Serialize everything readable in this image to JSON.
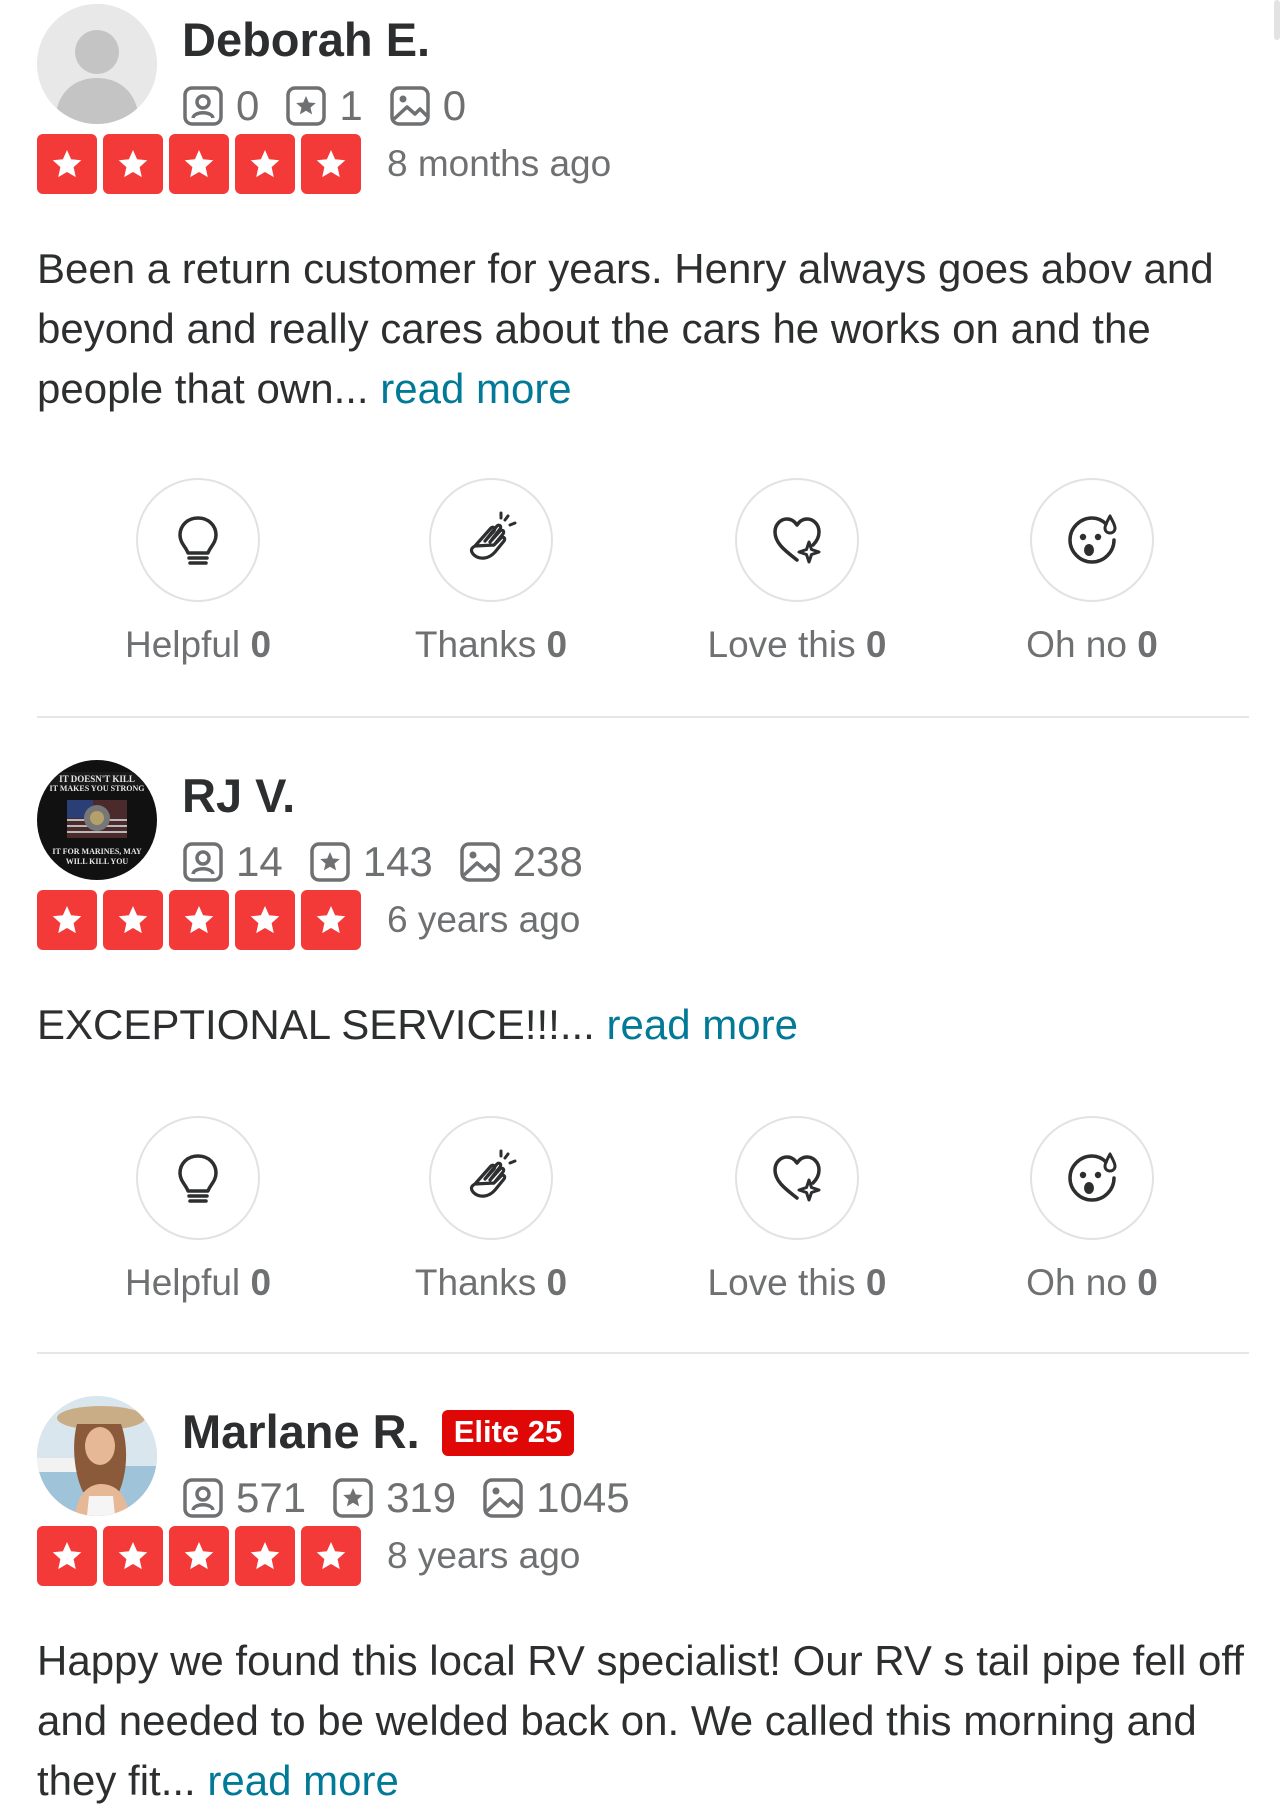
{
  "colors": {
    "star_red": "#f43939",
    "elite_red": "#e00707",
    "link": "#027a97",
    "muted": "#6e7072"
  },
  "reviews": [
    {
      "name": "Deborah E.",
      "elite": "",
      "avatar": "default-avatar-icon",
      "friends": "0",
      "reviews": "1",
      "photos": "0",
      "rating": 5,
      "date": "8 months ago",
      "text": "Been a return customer for years. Henry always goes abov and beyond and really cares about the cars he works on and the people that own...",
      "read_more": "read more",
      "reactions": {
        "helpful": {
          "label": "Helpful",
          "count": "0"
        },
        "thanks": {
          "label": "Thanks",
          "count": "0"
        },
        "love": {
          "label": "Love this",
          "count": "0"
        },
        "ohno": {
          "label": "Oh no",
          "count": "0"
        }
      }
    },
    {
      "name": "RJ V.",
      "elite": "",
      "avatar": "marine-emblem-photo",
      "friends": "14",
      "reviews": "143",
      "photos": "238",
      "rating": 5,
      "date": "6 years ago",
      "text": "EXCEPTIONAL SERVICE!!!...",
      "read_more": "read more",
      "reactions": {
        "helpful": {
          "label": "Helpful",
          "count": "0"
        },
        "thanks": {
          "label": "Thanks",
          "count": "0"
        },
        "love": {
          "label": "Love this",
          "count": "0"
        },
        "ohno": {
          "label": "Oh no",
          "count": "0"
        }
      }
    },
    {
      "name": "Marlane R.",
      "elite": "Elite 25",
      "avatar": "woman-portrait-photo",
      "friends": "571",
      "reviews": "319",
      "photos": "1045",
      "rating": 5,
      "date": "8 years ago",
      "text": "Happy we found this local RV specialist! Our RV s tail pipe fell off and needed to be welded back on. We called this morning and they fit...",
      "read_more": "read more"
    }
  ]
}
